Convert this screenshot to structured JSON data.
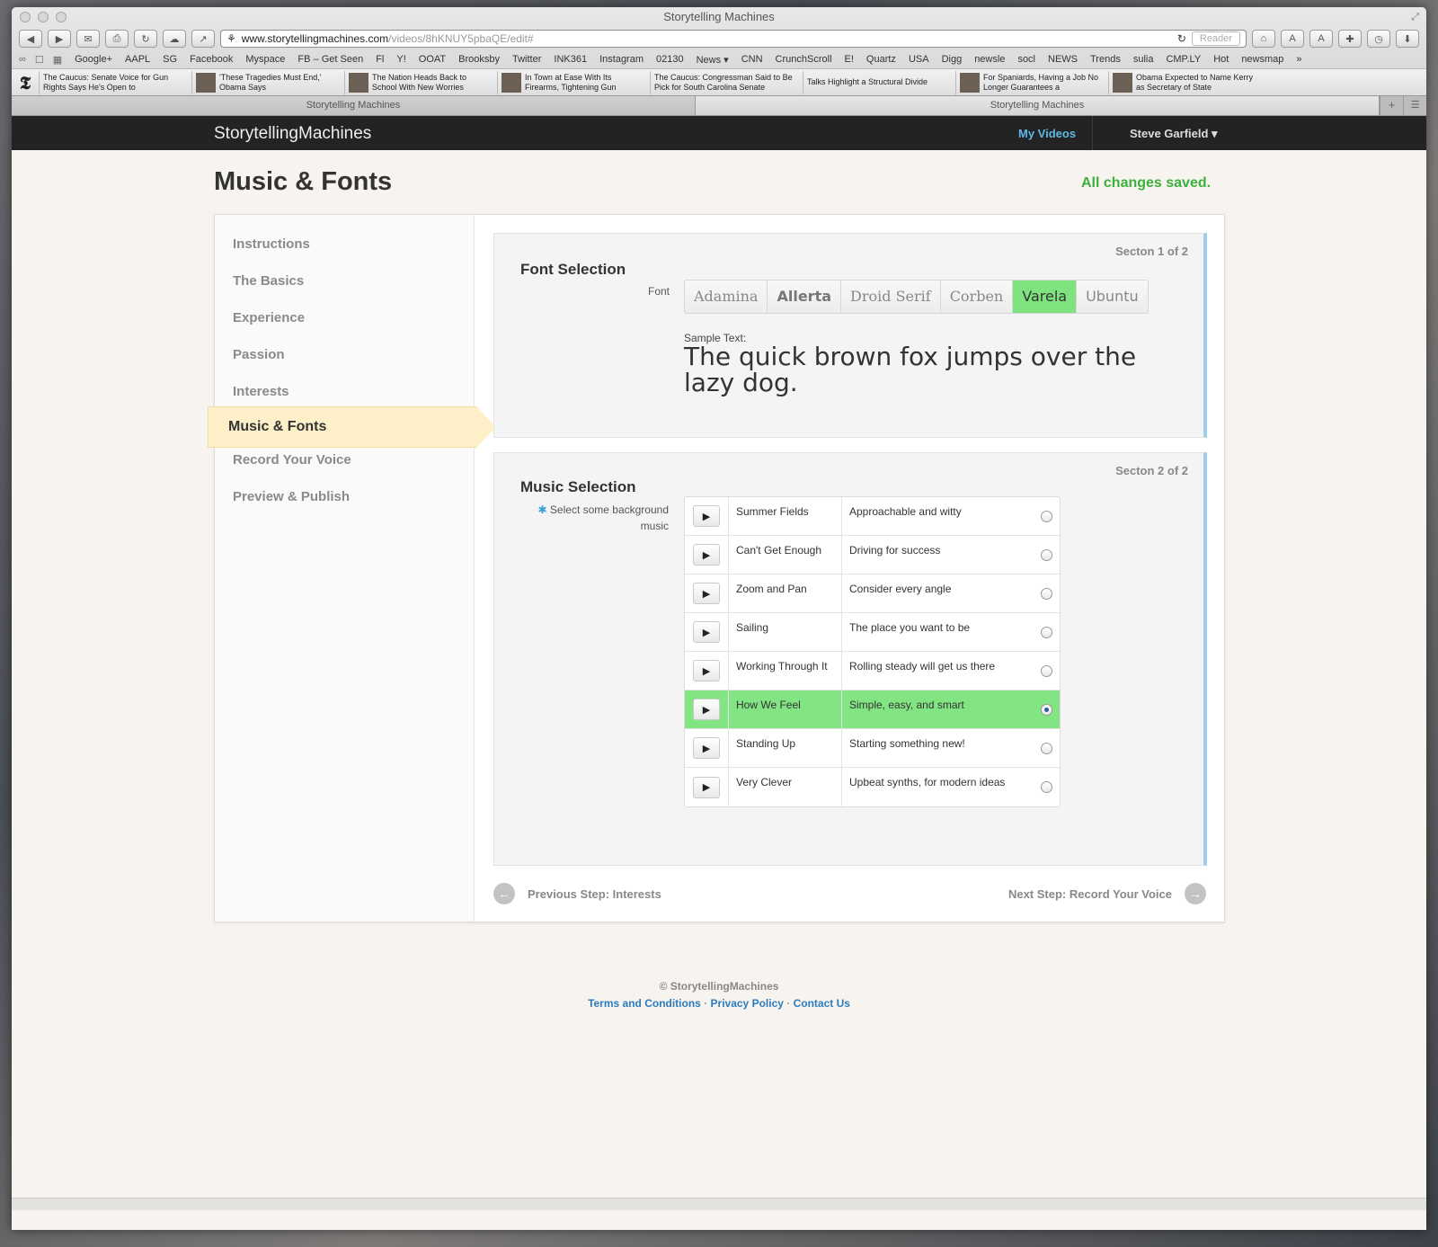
{
  "browser": {
    "window_title": "Storytelling Machines",
    "url_host": "www.storytellingmachines.com",
    "url_path": "/videos/8hKNUY5pbaQE/edit#",
    "reader_label": "Reader",
    "bookmarks": [
      "Google+",
      "AAPL",
      "SG",
      "Facebook",
      "Myspace",
      "FB – Get Seen",
      "Fl",
      "Y!",
      "OOAT",
      "Brooksby",
      "Twitter",
      "INK361",
      "Instagram",
      "02130",
      "News ▾",
      "CNN",
      "CrunchScroll",
      "E!",
      "Quartz",
      "USA",
      "Digg",
      "newsle",
      "socl",
      "NEWS",
      "Trends",
      "sulia",
      "CMP.LY",
      "Hot",
      "newsmap"
    ],
    "news": [
      "The Caucus: Senate Voice for Gun Rights Says He's Open to",
      "'These Tragedies Must End,' Obama Says",
      "The Nation Heads Back to School With New Worries",
      "In Town at Ease With Its Firearms, Tightening Gun",
      "The Caucus: Congressman Said to Be Pick for South Carolina Senate",
      "Talks Highlight a Structural Divide",
      "For Spaniards, Having a Job No Longer Guarantees a",
      "Obama Expected to Name Kerry as Secretary of State"
    ],
    "tabs": [
      "Storytelling Machines",
      "Storytelling Machines"
    ],
    "tab_add": "+"
  },
  "site": {
    "brand": "StorytellingMachines",
    "nav_my_videos": "My Videos",
    "nav_user": "Steve Garfield ▾",
    "page_title": "Music & Fonts",
    "saved_status": "All changes saved."
  },
  "sidenav": {
    "items": [
      "Instructions",
      "The Basics",
      "Experience",
      "Passion",
      "Interests",
      "Music & Fonts",
      "Record Your Voice",
      "Preview & Publish"
    ]
  },
  "font_section": {
    "counter": "Secton 1 of 2",
    "title": "Font Selection",
    "font_label": "Font",
    "fonts": [
      "Adamina",
      "Allerta",
      "Droid Serif",
      "Corben",
      "Varela",
      "Ubuntu"
    ],
    "selected_font": "Varela",
    "sample_label": "Sample Text:",
    "sample_text": "The quick brown fox jumps over the lazy dog."
  },
  "music_section": {
    "counter": "Secton 2 of 2",
    "title": "Music Selection",
    "hint_star": "✱",
    "hint": "Select some background music",
    "tracks": [
      {
        "name": "Summer Fields",
        "desc": "Approachable and witty",
        "selected": false
      },
      {
        "name": "Can't Get Enough",
        "desc": "Driving for success",
        "selected": false
      },
      {
        "name": "Zoom and Pan",
        "desc": "Consider every angle",
        "selected": false
      },
      {
        "name": "Sailing",
        "desc": "The place you want to be",
        "selected": false
      },
      {
        "name": "Working Through It",
        "desc": "Rolling steady will get us there",
        "selected": false
      },
      {
        "name": "How We Feel",
        "desc": "Simple, easy, and smart",
        "selected": true
      },
      {
        "name": "Standing Up",
        "desc": "Starting something new!",
        "selected": false
      },
      {
        "name": "Very Clever",
        "desc": "Upbeat synths, for modern ideas",
        "selected": false
      }
    ]
  },
  "steps": {
    "prev": "Previous Step: Interests",
    "next": "Next Step: Record Your Voice"
  },
  "footer": {
    "copyright": "© StorytellingMachines",
    "terms": "Terms and Conditions",
    "privacy": "Privacy Policy",
    "contact": "Contact Us",
    "sep": " · "
  },
  "colors": {
    "selected_green": "#82e482",
    "saved_green": "#3bb13b",
    "link_blue": "#2b7bbf",
    "section_accent": "#9ecfe8"
  }
}
